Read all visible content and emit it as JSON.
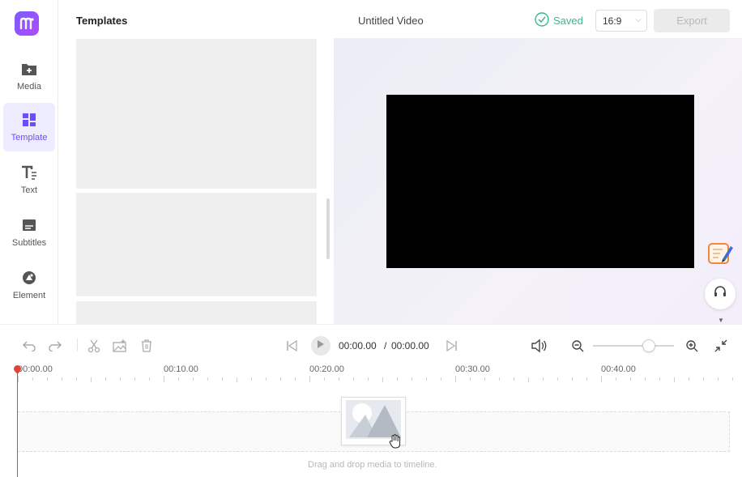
{
  "app": {
    "logo_icon": "app-logo-icon",
    "accent_color": "#6b4dff"
  },
  "rail": {
    "items": [
      {
        "label": "Media",
        "icon": "media-add-icon"
      },
      {
        "label": "Template",
        "icon": "template-icon"
      },
      {
        "label": "Text",
        "icon": "text-icon"
      },
      {
        "label": "Subtitles",
        "icon": "subtitles-icon"
      },
      {
        "label": "Element",
        "icon": "element-icon"
      }
    ],
    "active": "Template"
  },
  "panel": {
    "title": "Templates"
  },
  "header": {
    "video_title": "Untitled Video",
    "saved_label": "Saved",
    "aspect_ratio": "16:9",
    "export_label": "Export"
  },
  "toolbar": {
    "current_time": "00:00.00",
    "separator": "/",
    "total_time": "00:00.00",
    "zoom_level": 0.7
  },
  "timeline": {
    "ruler_labels": [
      "00:00.00",
      "00:10.00",
      "00:20.00",
      "00:30.00",
      "00:40.00"
    ],
    "drop_hint": "Drag and drop media to timeline."
  }
}
